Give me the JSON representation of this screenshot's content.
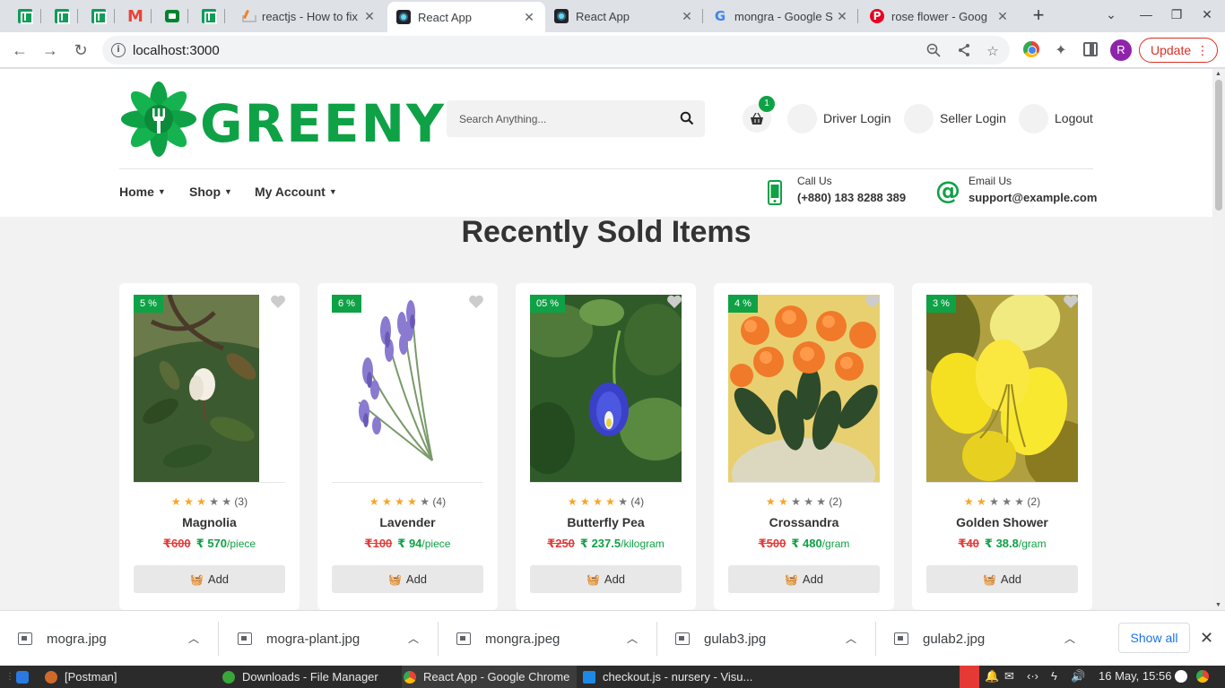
{
  "browser": {
    "tabs": [
      {
        "title": "reactjs - How to fix",
        "favicon": "stackoverflow-icon"
      },
      {
        "title": "React App",
        "favicon": "react-icon",
        "active": true
      },
      {
        "title": "React App",
        "favicon": "react-icon"
      },
      {
        "title": "mongra - Google S",
        "favicon": "google-icon"
      },
      {
        "title": "rose flower - Goog",
        "favicon": "pinterest-icon"
      }
    ],
    "url": "localhost:3000",
    "profile_initial": "R",
    "update_label": "Update"
  },
  "site": {
    "logo_text": "GREENY",
    "search_placeholder": "Search Anything...",
    "cart_count": "1",
    "header_links": [
      "Driver Login",
      "Seller Login",
      "Logout"
    ],
    "nav": [
      "Home",
      "Shop",
      "My Account"
    ],
    "call": {
      "label": "Call Us",
      "value": "(+880) 183 8288 389"
    },
    "email": {
      "label": "Email Us",
      "value": "support@example.com"
    },
    "section_title": "Recently Sold Items",
    "add_label": "Add",
    "products": [
      {
        "name": "Magnolia",
        "discount": "5 %",
        "rating": 3,
        "reviews": "(3)",
        "old_price": "₹600",
        "new_price": "₹ 570",
        "unit": "/piece"
      },
      {
        "name": "Lavender",
        "discount": "6 %",
        "rating": 4,
        "reviews": "(4)",
        "old_price": "₹100",
        "new_price": "₹ 94",
        "unit": "/piece"
      },
      {
        "name": "Butterfly Pea",
        "discount": "05 %",
        "rating": 4,
        "reviews": "(4)",
        "old_price": "₹250",
        "new_price": "₹ 237.5",
        "unit": "/kilogram"
      },
      {
        "name": "Crossandra",
        "discount": "4 %",
        "rating": 2,
        "reviews": "(2)",
        "old_price": "₹500",
        "new_price": "₹ 480",
        "unit": "/gram"
      },
      {
        "name": "Golden Shower",
        "discount": "3 %",
        "rating": 2,
        "reviews": "(2)",
        "old_price": "₹40",
        "new_price": "₹ 38.8",
        "unit": "/gram"
      }
    ]
  },
  "downloads": {
    "files": [
      "mogra.jpg",
      "mogra-plant.jpg",
      "mongra.jpeg",
      "gulab3.jpg",
      "gulab2.jpg"
    ],
    "show_all": "Show all"
  },
  "taskbar": {
    "items": [
      "[Postman]",
      "Downloads - File Manager",
      "React App - Google Chrome",
      "checkout.js - nursery - Visu..."
    ],
    "clock": "16 May, 15:56"
  },
  "colors": {
    "brand": "#0fa146",
    "sale": "#e53935",
    "star": "#f5a623"
  }
}
